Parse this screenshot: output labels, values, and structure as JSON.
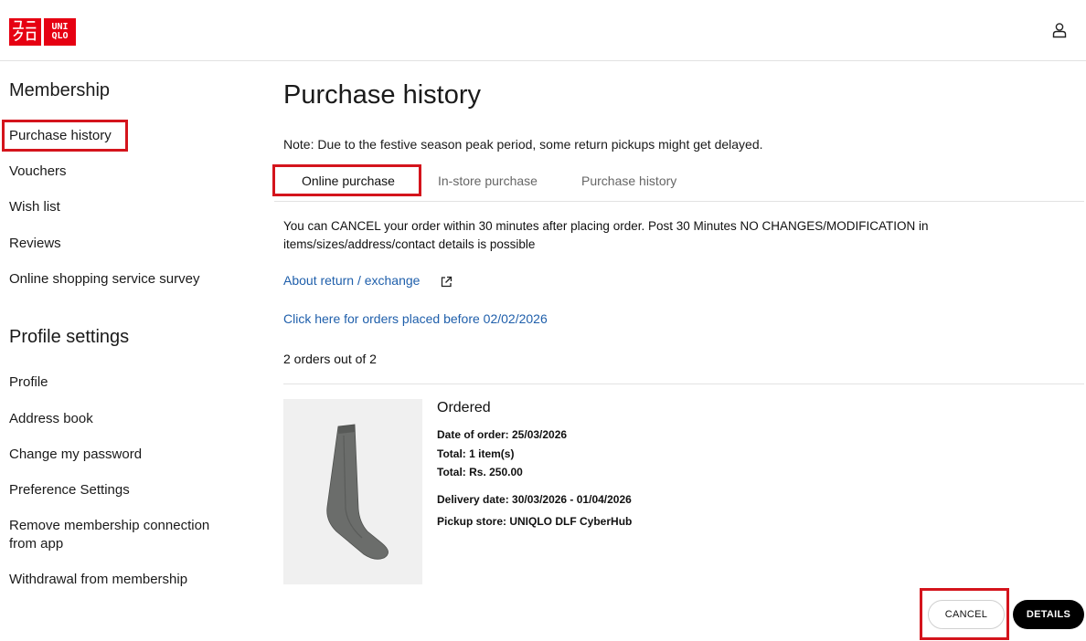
{
  "header": {
    "logo_top": "ユニ",
    "logo_bottom": "クロ",
    "logo_en_top": "UNI",
    "logo_en_bottom": "QLO",
    "account_icon": "user-icon",
    "brand_color": "#e60012"
  },
  "sidebar": {
    "membership_title": "Membership",
    "membership_items": [
      "Purchase history",
      "Vouchers",
      "Wish list",
      "Reviews",
      "Online shopping service survey"
    ],
    "profile_title": "Profile settings",
    "profile_items": [
      "Profile",
      "Address book",
      "Change my password",
      "Preference Settings",
      "Remove membership connection from app",
      "Withdrawal from membership"
    ]
  },
  "main": {
    "title": "Purchase history",
    "note": "Note: Due to the festive season peak period, some return pickups might get delayed.",
    "tabs": [
      "Online purchase",
      "In-store purchase",
      "Purchase history"
    ],
    "active_tab": "Online purchase",
    "info_text": "You can CANCEL your order within 30 minutes after placing order. Post 30 Minutes NO CHANGES/MODIFICATION in items/sizes/address/contact details is possible",
    "return_link": "About return / exchange",
    "external_icon": "external-link-icon",
    "old_orders_link": "Click here for orders placed before 02/02/2026",
    "orders_count": "2 orders out of 2"
  },
  "order": {
    "image": "grey-sock-product-image",
    "status": "Ordered",
    "date_of_order": "Date of order: 25/03/2026",
    "items": "Total: 1 item(s)",
    "total": "Total: Rs. 250.00",
    "delivery_date": "Delivery date: 30/03/2026 - 01/04/2026",
    "pickup_store": "Pickup store: UNIQLO DLF CyberHub",
    "cancel_label": "CANCEL",
    "details_label": "DETAILS"
  },
  "colors": {
    "highlight": "#d4141c",
    "link": "#1f5fab"
  }
}
